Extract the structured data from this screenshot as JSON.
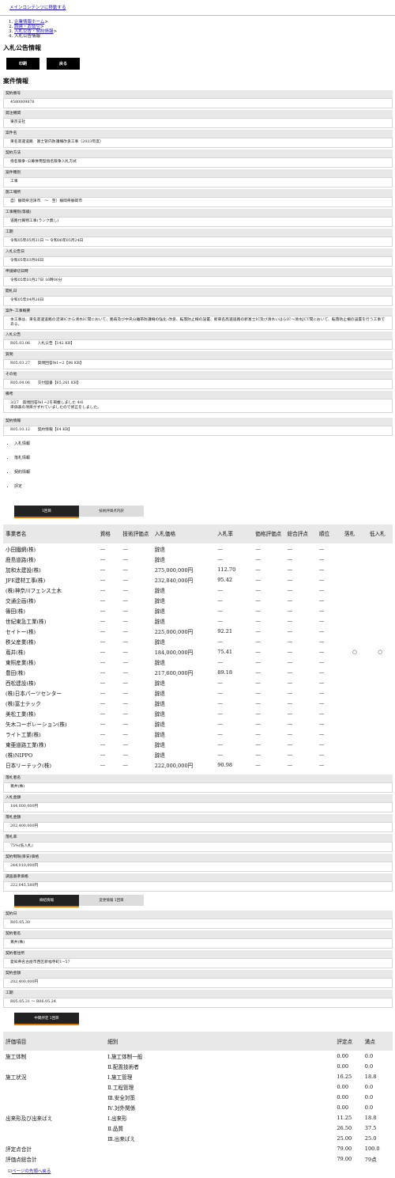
{
  "skip_link": "メインコンテンツに移動する",
  "breadcrumb": [
    "企業情報ホーム",
    "調達・お取引",
    "入札公告・契約情報",
    "入札公告情報"
  ],
  "page_title": "入札公告情報",
  "buttons": {
    "print": "印刷",
    "back": "戻る"
  },
  "section_title": "案件情報",
  "fields": [
    {
      "label": "契約番号",
      "value": "4580009876"
    },
    {
      "label": "発注機関",
      "value": "東京支社"
    },
    {
      "label": "案件名",
      "value": "東名高速道路　富士管内防護柵改良工事（2023年度）"
    },
    {
      "label": "契約方法",
      "value": "指名競争･公募併用型指名競争入札方式"
    },
    {
      "label": "案件種別",
      "value": "工事"
    },
    {
      "label": "施工場所",
      "value": "自）静岡県沼津市　～　至）静岡県静岡市"
    },
    {
      "label": "工事種別(等級)",
      "value": "道路付属物工事(ランク無し)"
    },
    {
      "label": "工期",
      "value": "令和05年05月31日 ～ 令和06年05月24日"
    },
    {
      "label": "入札公告日",
      "value": "令和05年03月06日"
    },
    {
      "label": "申請締切日時",
      "value": "令和05年03月27日 16時00分"
    },
    {
      "label": "開札日",
      "value": "令和05年04月26日"
    },
    {
      "label": "案件･工事概要",
      "value": "本工事は、東名高速道路の沼津ICから清水IC間において、路肩及び中央分離帯防護柵の強化･改良、転落防止柵の設置、新東名高速道路の新富士IC及び清水いはらIC～清水JCT間において、転落防止柵の設置を行う工事である。"
    },
    {
      "label": "入札公告",
      "value": "R05.03.06　　入札公告【142 KB】"
    },
    {
      "label": "質問",
      "value": "R05.03.27　　質問回答№1~2【96 KB】"
    },
    {
      "label": "その他",
      "value": "R05.04.06　　交付図書【65,261 KB】"
    },
    {
      "label": "備考",
      "value": "3/27　質問回答№1~2を掲載しました 4/6\n単価表の項目がずれていましたので修正をしました。"
    }
  ],
  "contract_info": {
    "label": "契約情報",
    "value": "R05.10.12　　契約情報【64 KB】"
  },
  "tab_links": [
    "入札情報",
    "落札情報",
    "契約情報",
    "評定"
  ],
  "bid_tabs": [
    "1回目",
    "技術評価点内訳"
  ],
  "bid_headers": [
    "事業者名",
    "資格",
    "技術評価点",
    "入札価格",
    "入札率",
    "価格評価点",
    "総合評点",
    "順位",
    "落札",
    "低入札"
  ],
  "bid_rows": [
    [
      "小田鐵網(株)",
      "—",
      "—",
      "辞退",
      "—",
      "—",
      "—",
      "—",
      "",
      ""
    ],
    [
      "鹿島道路(株)",
      "—",
      "—",
      "辞退",
      "—",
      "—",
      "—",
      "—",
      "",
      ""
    ],
    [
      "加和太建設(株)",
      "—",
      "—",
      "275,000,000円",
      "112.70",
      "—",
      "—",
      "—",
      "",
      ""
    ],
    [
      "JFE建材工事(株)",
      "—",
      "—",
      "232,840,000円",
      "95.42",
      "—",
      "—",
      "—",
      "",
      ""
    ],
    [
      "(株)神奈川フェンス土木",
      "—",
      "—",
      "辞退",
      "—",
      "—",
      "—",
      "—",
      "",
      ""
    ],
    [
      "交通企画(株)",
      "—",
      "—",
      "辞退",
      "—",
      "—",
      "—",
      "—",
      "",
      ""
    ],
    [
      "篠田(株)",
      "—",
      "—",
      "辞退",
      "—",
      "—",
      "—",
      "—",
      "",
      ""
    ],
    [
      "世紀東急工業(株)",
      "—",
      "—",
      "辞退",
      "—",
      "—",
      "—",
      "—",
      "",
      ""
    ],
    [
      "セイトー(株)",
      "—",
      "—",
      "225,000,000円",
      "92.21",
      "—",
      "—",
      "—",
      "",
      ""
    ],
    [
      "秩父産業(株)",
      "—",
      "—",
      "辞退",
      "—",
      "—",
      "—",
      "—",
      "",
      ""
    ],
    [
      "蔦井(株)",
      "—",
      "—",
      "184,000,000円",
      "75.41",
      "—",
      "—",
      "—",
      "○",
      "○"
    ],
    [
      "東照産業(株)",
      "—",
      "—",
      "辞退",
      "—",
      "—",
      "—",
      "—",
      "",
      ""
    ],
    [
      "豊田(株)",
      "—",
      "—",
      "217,600,000円",
      "89.18",
      "—",
      "—",
      "—",
      "",
      ""
    ],
    [
      "西松建設(株)",
      "—",
      "—",
      "辞退",
      "—",
      "—",
      "—",
      "—",
      "",
      ""
    ],
    [
      "(株)日本パーツセンター",
      "—",
      "—",
      "辞退",
      "—",
      "—",
      "—",
      "—",
      "",
      ""
    ],
    [
      "(株)富士テック",
      "—",
      "—",
      "辞退",
      "—",
      "—",
      "—",
      "—",
      "",
      ""
    ],
    [
      "美松工業(株)",
      "—",
      "—",
      "辞退",
      "—",
      "—",
      "—",
      "—",
      "",
      ""
    ],
    [
      "矢木コーポレーション(株)",
      "—",
      "—",
      "辞退",
      "—",
      "—",
      "—",
      "—",
      "",
      ""
    ],
    [
      "ライト工業(株)",
      "—",
      "—",
      "辞退",
      "—",
      "—",
      "—",
      "—",
      "",
      ""
    ],
    [
      "東亜道路工業(株)",
      "—",
      "—",
      "辞退",
      "—",
      "—",
      "—",
      "—",
      "",
      ""
    ],
    [
      "(株)NIPPO",
      "—",
      "—",
      "辞退",
      "—",
      "—",
      "—",
      "—",
      "",
      ""
    ],
    [
      "日本リーテック(株)",
      "—",
      "—",
      "222,000,000円",
      "90.98",
      "—",
      "—",
      "—",
      "",
      ""
    ]
  ],
  "award_fields": [
    {
      "label": "落札者名",
      "value": "蔦井(株)"
    },
    {
      "label": "入札金額",
      "value": "184,000,000円"
    },
    {
      "label": "落札金額",
      "value": "202,400,000円"
    },
    {
      "label": "落札率",
      "value": "75%(低入札)"
    },
    {
      "label": "契約制限(目安)価格",
      "value": "244,010,000円"
    },
    {
      "label": "調査基準価格",
      "value": "222,045,580円"
    }
  ],
  "contract_tabs": [
    "締結情報",
    "変更情報\n1回目"
  ],
  "contract_fields": [
    {
      "label": "契約日",
      "value": "R05.05.30"
    },
    {
      "label": "契約者名",
      "value": "蔦井(株)"
    },
    {
      "label": "契約者住所",
      "value": "愛知県名古屋市西区新福寺町1−57"
    },
    {
      "label": "契約金額",
      "value": "202,400,000円"
    },
    {
      "label": "工期",
      "value": "R05.05.31 ～ R06.05.24"
    }
  ],
  "eval_tab": "中間評定\n1回目",
  "eval_headers": [
    "評価項目",
    "細別",
    "評定点",
    "満点"
  ],
  "eval_rows": [
    [
      "施工体制",
      "Ⅰ.施工体制一般",
      "0.00",
      "0.0"
    ],
    [
      "",
      "Ⅱ.配置技術者",
      "0.00",
      "0.0"
    ],
    [
      "施工状況",
      "Ⅰ.施工管理",
      "16.25",
      "18.8"
    ],
    [
      "",
      "Ⅱ.工程管理",
      "0.00",
      "0.0"
    ],
    [
      "",
      "Ⅲ.安全対策",
      "0.00",
      "0.0"
    ],
    [
      "",
      "Ⅳ.対外関係",
      "0.00",
      "0.0"
    ],
    [
      "出来形及び出来ばえ",
      "Ⅰ.出来形",
      "11.25",
      "18.8"
    ],
    [
      "",
      "Ⅱ.品質",
      "26.50",
      "37.5"
    ],
    [
      "",
      "Ⅲ.出来ばえ",
      "25.00",
      "25.0"
    ],
    [
      "評定点合計",
      "",
      "79.00",
      "100.0"
    ],
    [
      "評価点総合計",
      "",
      "79.00",
      "79点"
    ]
  ],
  "footer_link": "ページの先頭へ戻る"
}
